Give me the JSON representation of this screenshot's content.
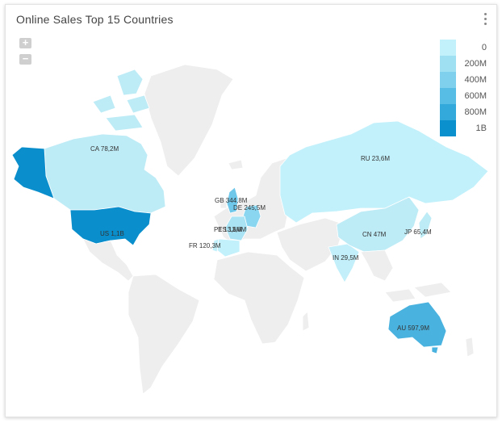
{
  "title": "Online Sales Top 15 Countries",
  "zoom": {
    "in": "+",
    "out": "−"
  },
  "icons": {
    "menu": "more-vert-icon",
    "zoom_in": "plus-icon",
    "zoom_out": "minus-icon"
  },
  "colors": {
    "no_data": "#eeeeee",
    "border": "#ffffff"
  },
  "legend": [
    {
      "label": "0",
      "color": "#c2f1fb"
    },
    {
      "label": "200M",
      "color": "#9fe1f3"
    },
    {
      "label": "400M",
      "color": "#7fd0ec"
    },
    {
      "label": "600M",
      "color": "#58bde4"
    },
    {
      "label": "800M",
      "color": "#33a8da"
    },
    {
      "label": "1B",
      "color": "#0a90cc"
    }
  ],
  "countries": [
    {
      "code": "US",
      "label": "US 1,1B",
      "value": 1100000000,
      "color": "#0a8fcc"
    },
    {
      "code": "AU",
      "label": "AU 597,9M",
      "value": 597900000,
      "color": "#4ab2df"
    },
    {
      "code": "GB",
      "label": "GB 344,8M",
      "value": 344800000,
      "color": "#6fc7ea"
    },
    {
      "code": "DE",
      "label": "DE 245,5M",
      "value": 245500000,
      "color": "#8ad6f0"
    },
    {
      "code": "FR",
      "label": "FR 120,3M",
      "value": 120300000,
      "color": "#a9e3f4"
    },
    {
      "code": "CA",
      "label": "CA 78,2M",
      "value": 78200000,
      "color": "#bdebf6"
    },
    {
      "code": "JP",
      "label": "JP 65,4M",
      "value": 65400000,
      "color": "#bdebf6"
    },
    {
      "code": "CN",
      "label": "CN 47M",
      "value": 47000000,
      "color": "#bdebf6"
    },
    {
      "code": "IN",
      "label": "IN 29,5M",
      "value": 29500000,
      "color": "#c2eff9"
    },
    {
      "code": "RU",
      "label": "RU 23,6M",
      "value": 23600000,
      "color": "#c2f1fb"
    },
    {
      "code": "PT",
      "label": "PT 13,6M",
      "value": 13600000,
      "color": "#c2f1fb"
    },
    {
      "code": "ES",
      "label": "ES 13,6M",
      "value": 13600000,
      "color": "#c2f1fb"
    }
  ]
}
